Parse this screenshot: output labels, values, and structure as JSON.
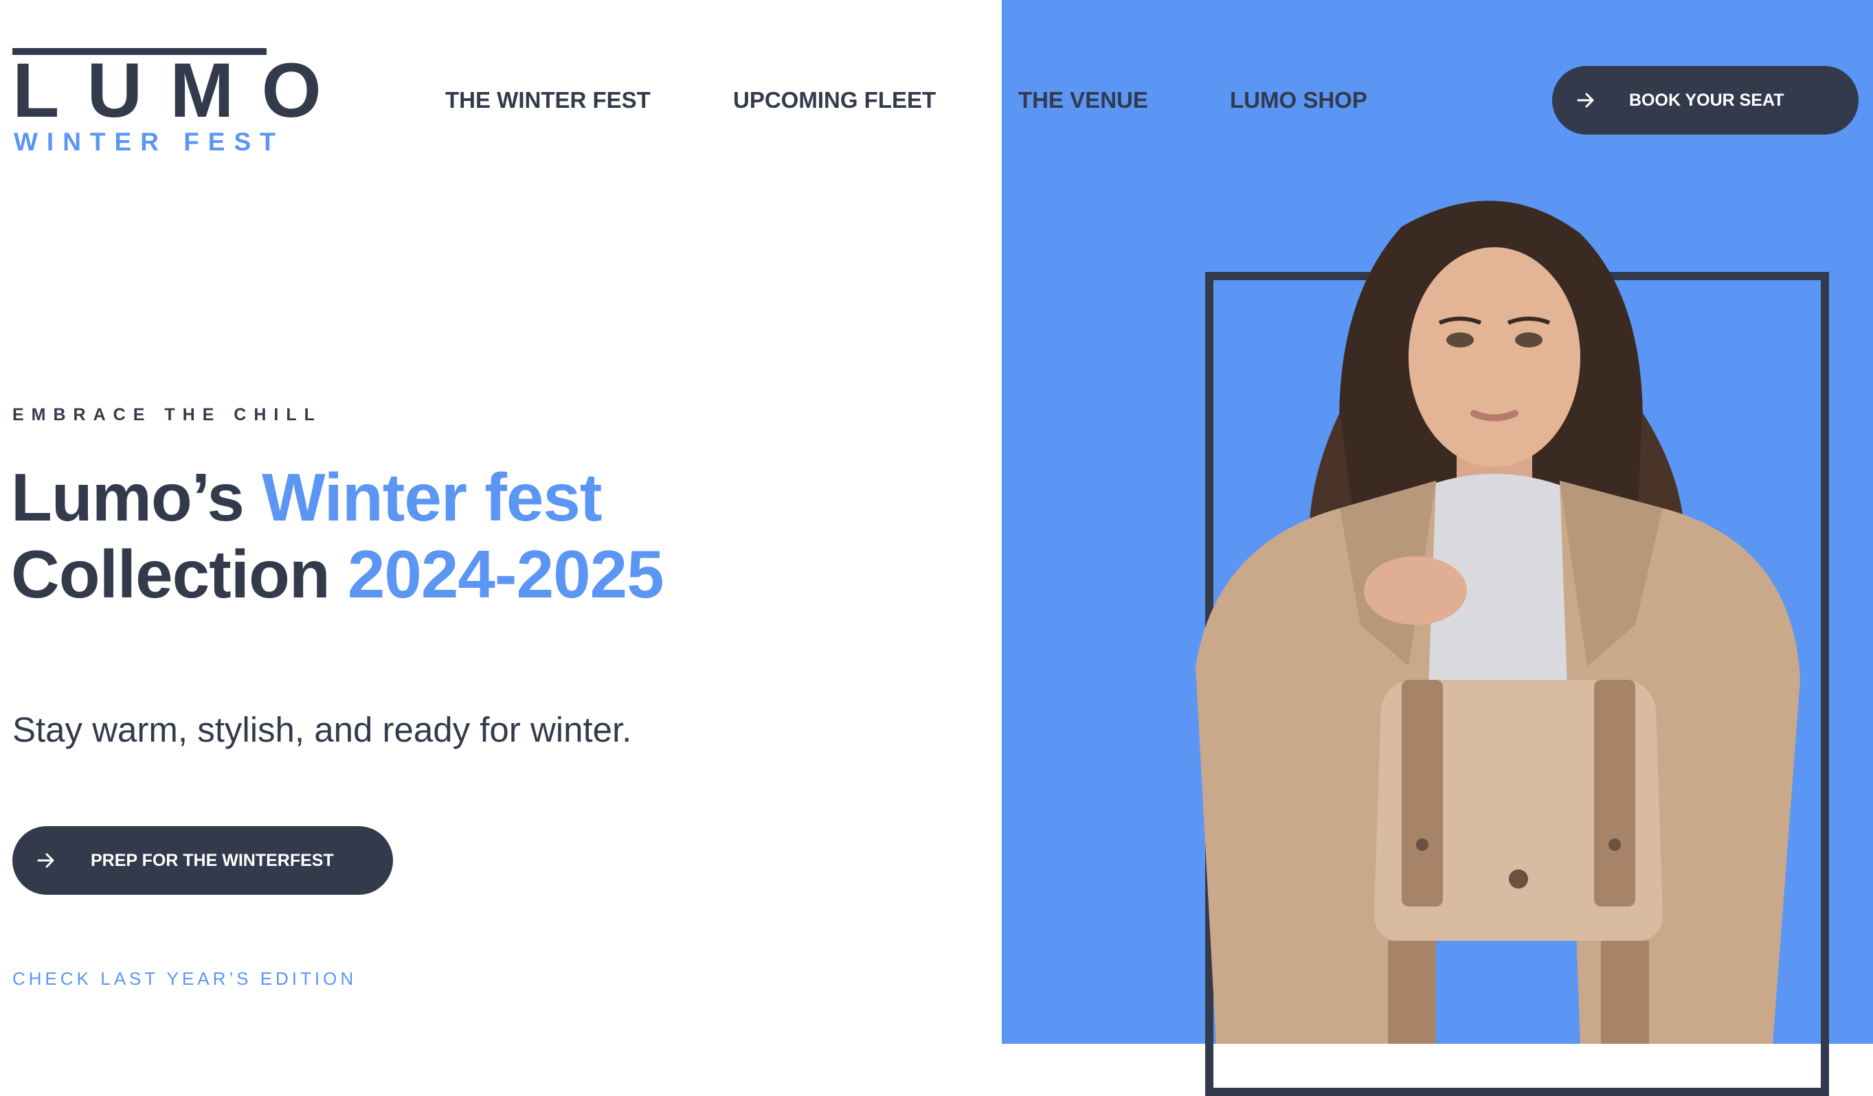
{
  "logo": {
    "wordmark": "LUMO",
    "subtitle": "WINTER FEST"
  },
  "nav": {
    "items": [
      {
        "label": "THE WINTER FEST"
      },
      {
        "label": "UPCOMING FLEET"
      },
      {
        "label": "THE VENUE"
      },
      {
        "label": "LUMO SHOP"
      }
    ],
    "cta": {
      "label": "BOOK YOUR SEAT",
      "icon": "arrow-right-icon"
    }
  },
  "hero": {
    "eyebrow": "EMBRACE THE CHILL",
    "headline": {
      "line1_dark": "Lumo’s",
      "line1_accent": "Winter fest",
      "line2_dark": "Collection",
      "line2_accent": "2024-2025"
    },
    "subtext": "Stay warm, stylish, and ready for winter.",
    "primary_cta": {
      "label": "PREP FOR THE WINTERFEST",
      "icon": "arrow-right-icon"
    },
    "secondary_link": "CHECK LAST YEAR’S EDITION"
  },
  "colors": {
    "accent": "#5b96f4",
    "dark": "#323a4b",
    "background": "#ffffff"
  }
}
